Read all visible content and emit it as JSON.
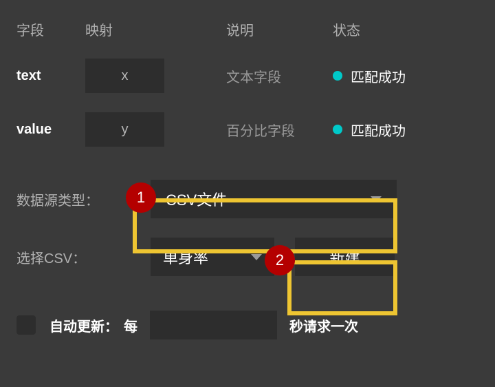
{
  "headers": {
    "field": "字段",
    "mapping": "映射",
    "desc": "说明",
    "status": "状态"
  },
  "rows": [
    {
      "field": "text",
      "mapping": "x",
      "desc": "文本字段",
      "status": "匹配成功"
    },
    {
      "field": "value",
      "mapping": "y",
      "desc": "百分比字段",
      "status": "匹配成功"
    }
  ],
  "colors": {
    "statusDot": "#00c9c9",
    "highlight": "#eec532",
    "callout": "#b40000"
  },
  "form": {
    "sourceTypeLabel": "数据源类型：",
    "sourceTypeValue": "CSV文件",
    "selectCsvLabel": "选择CSV：",
    "selectCsvValue": "单身率",
    "newButton": "新建"
  },
  "autoUpdate": {
    "label": "自动更新：",
    "prefix": "每",
    "suffix": "秒请求一次",
    "value": ""
  },
  "callouts": {
    "one": "1",
    "two": "2"
  }
}
